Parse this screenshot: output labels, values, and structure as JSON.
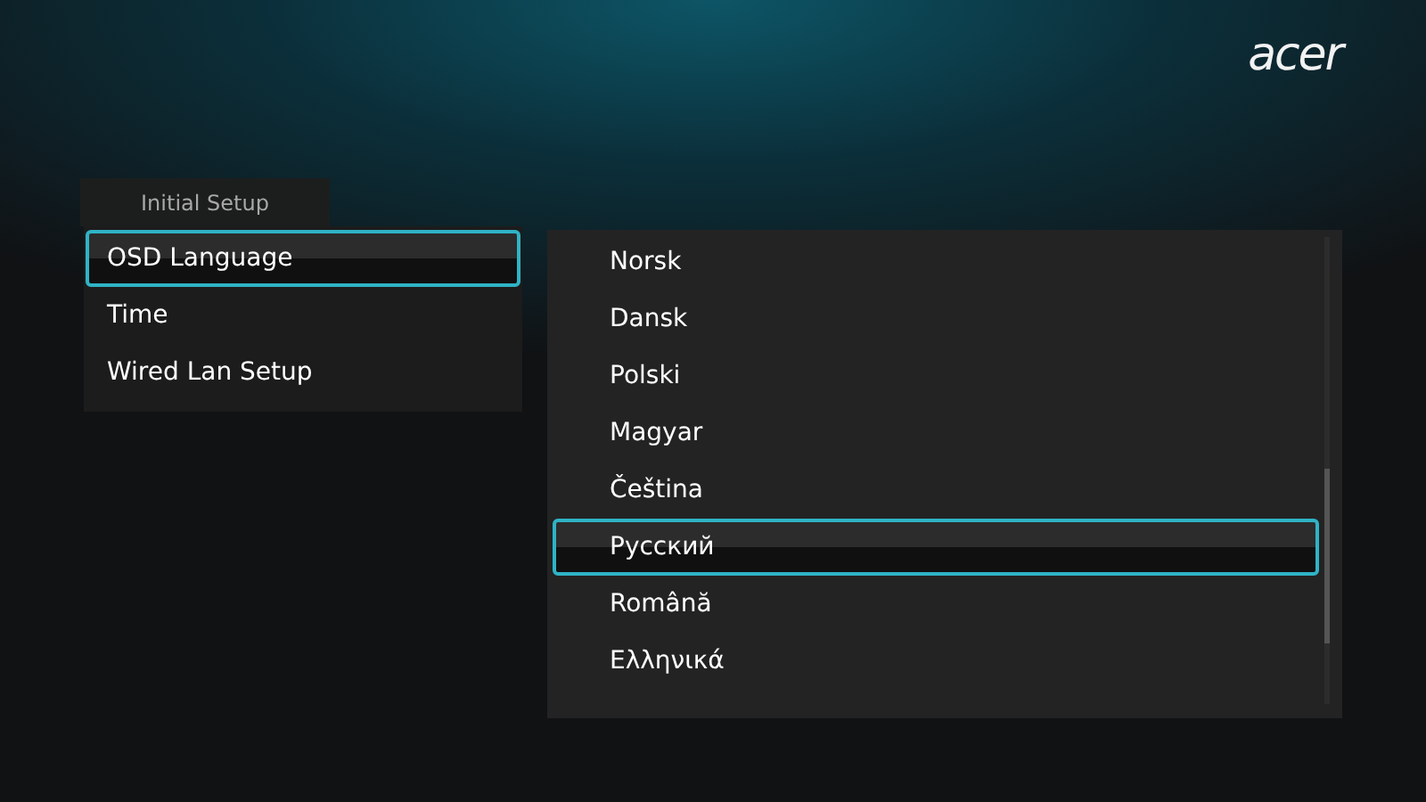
{
  "logo": "acer",
  "tab": {
    "label": "Initial Setup"
  },
  "menu": [
    {
      "label": "OSD Language",
      "selected": true
    },
    {
      "label": "Time",
      "selected": false
    },
    {
      "label": "Wired Lan Setup",
      "selected": false
    }
  ],
  "languages": [
    {
      "label": "Norsk",
      "selected": false
    },
    {
      "label": "Dansk",
      "selected": false
    },
    {
      "label": "Polski",
      "selected": false
    },
    {
      "label": "Magyar",
      "selected": false
    },
    {
      "label": "Čeština",
      "selected": false
    },
    {
      "label": "Русский",
      "selected": true
    },
    {
      "label": "Română",
      "selected": false
    },
    {
      "label": "Ελληνικά",
      "selected": false
    }
  ]
}
